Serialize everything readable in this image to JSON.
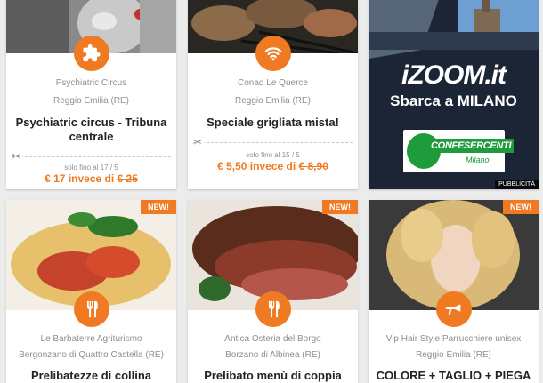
{
  "accent": "#ef7a22",
  "cards": [
    {
      "merchant": "Psychiatric Circus",
      "city": "Reggio Emilia (RE)",
      "title_line1": "Psychiatric circus - Tribuna",
      "title_line2": "centrale",
      "icon": "puzzle-icon",
      "until": "solo fino al 17 / 5",
      "price_new": "€ 17 invece di ",
      "price_old": "€ 25"
    },
    {
      "merchant": "Conad Le Querce",
      "city": "Reggio Emilia (RE)",
      "title_line1": "Speciale grigliata mista!",
      "icon": "wifi-icon",
      "until": "solo fino al 15 / 5",
      "price_new": "€ 5,50 invece di ",
      "price_old": "€ 8,90"
    },
    {
      "merchant": "Le Barbaterre Agriturismo",
      "city": "Bergonzano di Quattro Castella (RE)",
      "title_line1": "Prelibatezze di collina",
      "icon": "cutlery-icon",
      "tag": "NEW!"
    },
    {
      "merchant": "Antica Osteria del Borgo",
      "city": "Borzano di Albinea (RE)",
      "title_line1": "Prelibato menù di coppia",
      "icon": "cutlery-icon",
      "tag": "NEW!"
    },
    {
      "merchant": "Vip Hair Style Parrucchiere unisex",
      "city": "Reggio Emilia (RE)",
      "title_line1": "COLORE + TAGLIO + PIEGA",
      "icon": "hairdryer-icon",
      "tag": "NEW!"
    }
  ],
  "ad": {
    "brand": "iZOOM.it",
    "headline": "Sbarca a MILANO",
    "logo_text": "CONFESERCENTI",
    "logo_sub": "Milano",
    "label": "PUBBLICITÀ"
  }
}
